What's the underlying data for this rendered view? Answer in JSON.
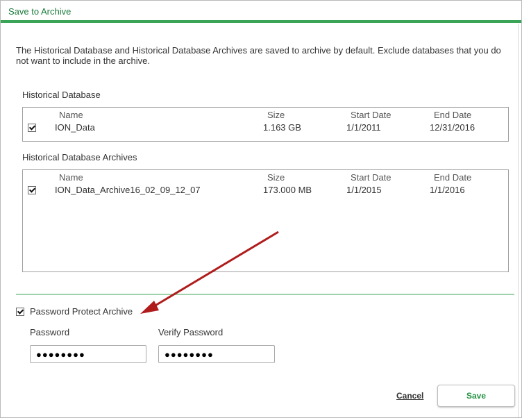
{
  "window": {
    "title": "Save to Archive"
  },
  "intro_text": "The Historical Database and Historical Database Archives are saved to archive by default.  Exclude databases that you do not want to include in the archive.",
  "historical_database": {
    "label": "Historical Database",
    "columns": {
      "name": "Name",
      "size": "Size",
      "start": "Start Date",
      "end": "End Date"
    },
    "rows": [
      {
        "checked": true,
        "name": "ION_Data",
        "size": "1.163 GB",
        "start": "1/1/2011",
        "end": "12/31/2016"
      }
    ]
  },
  "archives": {
    "label": "Historical Database Archives",
    "columns": {
      "name": "Name",
      "size": "Size",
      "start": "Start Date",
      "end": "End Date"
    },
    "rows": [
      {
        "checked": true,
        "name": "ION_Data_Archive16_02_09_12_07",
        "size": "173.000 MB",
        "start": "1/1/2015",
        "end": "1/1/2016"
      }
    ]
  },
  "password": {
    "protect_label": "Password Protect Archive",
    "protect_checked": true,
    "password_label": "Password",
    "password_value": "●●●●●●●●",
    "verify_label": "Verify Password",
    "verify_value": "●●●●●●●●"
  },
  "buttons": {
    "cancel": "Cancel",
    "save": "Save"
  },
  "colors": {
    "accent": "#3aa557",
    "title_text": "#1a7a3a",
    "save_text": "#239142",
    "annotation_arrow": "#b01c1c"
  }
}
